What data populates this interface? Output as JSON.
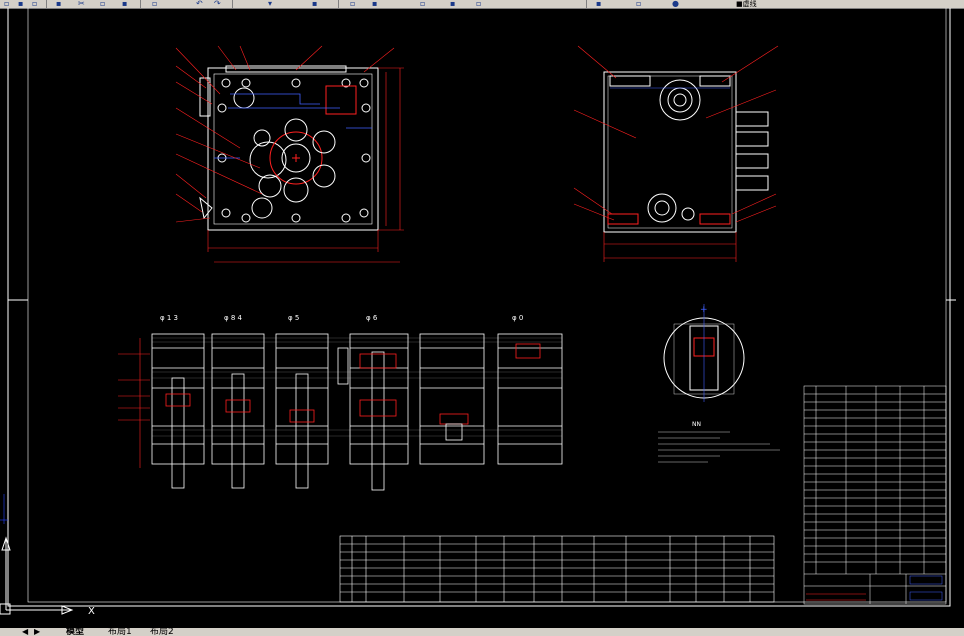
{
  "toolbar": {
    "icons": [
      "new-icon",
      "open-icon",
      "save-icon",
      "print-icon",
      "cut-icon",
      "copy-icon",
      "paste-icon",
      "match-icon",
      "undo-icon",
      "redo-icon",
      "pan-icon",
      "zoom-realtime-icon",
      "zoom-window-icon",
      "zoom-previous-icon",
      "properties-icon",
      "design-center-icon",
      "tool-palette-icon",
      "layer-icon",
      "layer-state-icon",
      "color-icon"
    ],
    "layer_name": "■虚线"
  },
  "drawing": {
    "section_labels": [
      "φ 1 3",
      "φ 8 4",
      "φ 5",
      "φ 6",
      "φ 0"
    ],
    "notes_title": "NN",
    "detail_marker": "+",
    "ucs_label": "X",
    "colors": {
      "frame": "#ffffff",
      "dimension": "#ff2020",
      "geometry": "#ffffff",
      "hidden": "#4060ff",
      "leader": "#ff2020",
      "cursor": "#2040ff"
    }
  },
  "tabs": {
    "nav": [
      "◀",
      "▶"
    ],
    "items": [
      "模型",
      "布局1",
      "布局2"
    ],
    "active": "模型"
  }
}
